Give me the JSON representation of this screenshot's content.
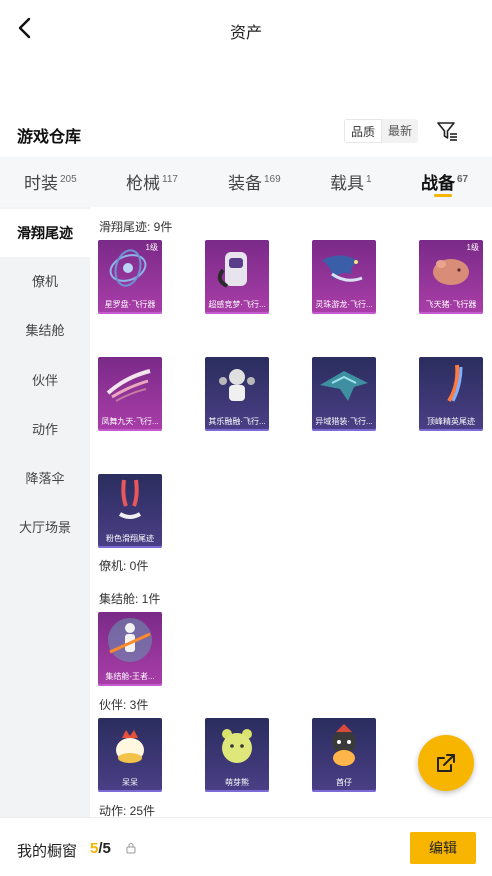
{
  "header": {
    "title": "资产"
  },
  "warehouse": {
    "title": "游戏仓库",
    "sort_quality": "品质",
    "sort_newest": "最新"
  },
  "tabs": [
    {
      "label": "时装",
      "count": "205"
    },
    {
      "label": "枪械",
      "count": "117"
    },
    {
      "label": "装备",
      "count": "169"
    },
    {
      "label": "载具",
      "count": "1"
    },
    {
      "label": "战备",
      "count": "67",
      "active": true
    }
  ],
  "sidebar": [
    {
      "label": "滑翔尾迹",
      "active": true
    },
    {
      "label": "僚机"
    },
    {
      "label": "集结舱"
    },
    {
      "label": "伙伴"
    },
    {
      "label": "动作"
    },
    {
      "label": "降落伞"
    },
    {
      "label": "大厅场景"
    }
  ],
  "sections": {
    "glide": {
      "title": "滑翔尾迹: 9件"
    },
    "wingman": {
      "title": "僚机: 0件"
    },
    "rally": {
      "title": "集结舱: 1件"
    },
    "partner": {
      "title": "伙伴: 3件"
    },
    "action": {
      "title": "动作: 25件"
    }
  },
  "items": {
    "glide": [
      {
        "label": "星罗盘·飞行器",
        "level": "1级",
        "rarity": "pink"
      },
      {
        "label": "超感竞梦·飞行...",
        "rarity": "pink"
      },
      {
        "label": "灵珠游龙·飞行...",
        "rarity": "pink"
      },
      {
        "label": "飞天猪·飞行器",
        "level": "1级",
        "rarity": "pink"
      },
      {
        "label": "凤舞九天·飞行...",
        "rarity": "pink"
      },
      {
        "label": "其乐融融·飞行...",
        "rarity": "purple"
      },
      {
        "label": "异域猎装·飞行...",
        "rarity": "purple"
      },
      {
        "label": "顶峰精英尾迹",
        "rarity": "purple"
      },
      {
        "label": "粉色滑翔尾迹",
        "rarity": "purple"
      }
    ],
    "rally": [
      {
        "label": "集结舱-王者...",
        "rarity": "pink"
      }
    ],
    "partner": [
      {
        "label": "呆呆",
        "rarity": "purple"
      },
      {
        "label": "萌芽熊",
        "rarity": "purple"
      },
      {
        "label": "酋仔",
        "rarity": "purple"
      }
    ]
  },
  "bottom": {
    "window_label": "我的橱窗",
    "window_current": "5",
    "window_sep": "/",
    "window_max": "5",
    "edit_label": "编辑"
  },
  "colors": {
    "accent": "#f7b500",
    "pink_rarity": "#a93ea8",
    "purple_rarity": "#4b3f86"
  },
  "icons": {
    "back": "chevron-left-icon",
    "filter": "filter-icon",
    "share": "share-icon",
    "lock": "lock-icon"
  }
}
